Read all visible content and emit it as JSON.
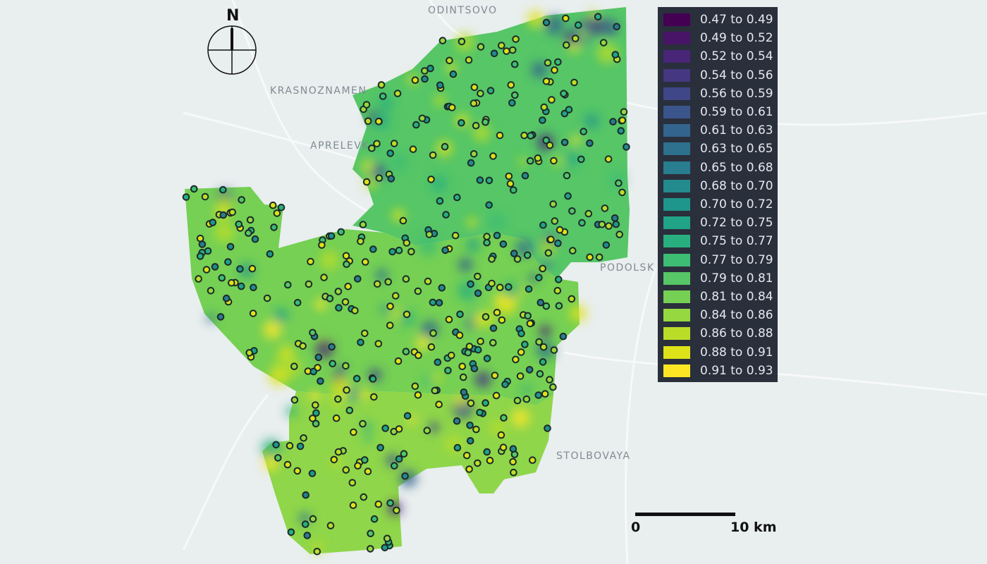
{
  "place_labels": {
    "odintsovo": "ODINTSOVO",
    "krasnoznamensk": "KRASNOZNAMEN",
    "aprelevka": "APRELEVK",
    "podolsk": "PODOLSK",
    "stolbovaya": "STOLBOVAYA"
  },
  "north_arrow": {
    "label": "N"
  },
  "scale_bar": {
    "start_label": "0",
    "end_label": "10 km"
  },
  "legend": [
    {
      "label": "0.47 to 0.49",
      "color": "#440154"
    },
    {
      "label": "0.49 to 0.52",
      "color": "#481467"
    },
    {
      "label": "0.52 to 0.54",
      "color": "#482576"
    },
    {
      "label": "0.54 to 0.56",
      "color": "#453781"
    },
    {
      "label": "0.56 to 0.59",
      "color": "#3f4788"
    },
    {
      "label": "0.59 to 0.61",
      "color": "#39558c"
    },
    {
      "label": "0.61 to 0.63",
      "color": "#32648e"
    },
    {
      "label": "0.63 to 0.65",
      "color": "#2d718e"
    },
    {
      "label": "0.65 to 0.68",
      "color": "#287d8e"
    },
    {
      "label": "0.68 to 0.70",
      "color": "#238a8d"
    },
    {
      "label": "0.70 to 0.72",
      "color": "#1f968b"
    },
    {
      "label": "0.72 to 0.75",
      "color": "#20a386"
    },
    {
      "label": "0.75 to 0.77",
      "color": "#29af7f"
    },
    {
      "label": "0.77 to 0.79",
      "color": "#3dbc74"
    },
    {
      "label": "0.79 to 0.81",
      "color": "#56c667"
    },
    {
      "label": "0.81 to 0.84",
      "color": "#75d054"
    },
    {
      "label": "0.84 to 0.86",
      "color": "#95d840"
    },
    {
      "label": "0.86 to 0.88",
      "color": "#bade28"
    },
    {
      "label": "0.88 to 0.91",
      "color": "#dde318"
    },
    {
      "label": "0.91 to 0.93",
      "color": "#fde725"
    }
  ],
  "colors": {
    "background": "#e9eeee",
    "region_north": "#56c667",
    "region_center": "#75d054",
    "region_south": "#8fd64a",
    "point_stroke": "#1c2a2a",
    "legend_bg": "#2a2f3c"
  }
}
